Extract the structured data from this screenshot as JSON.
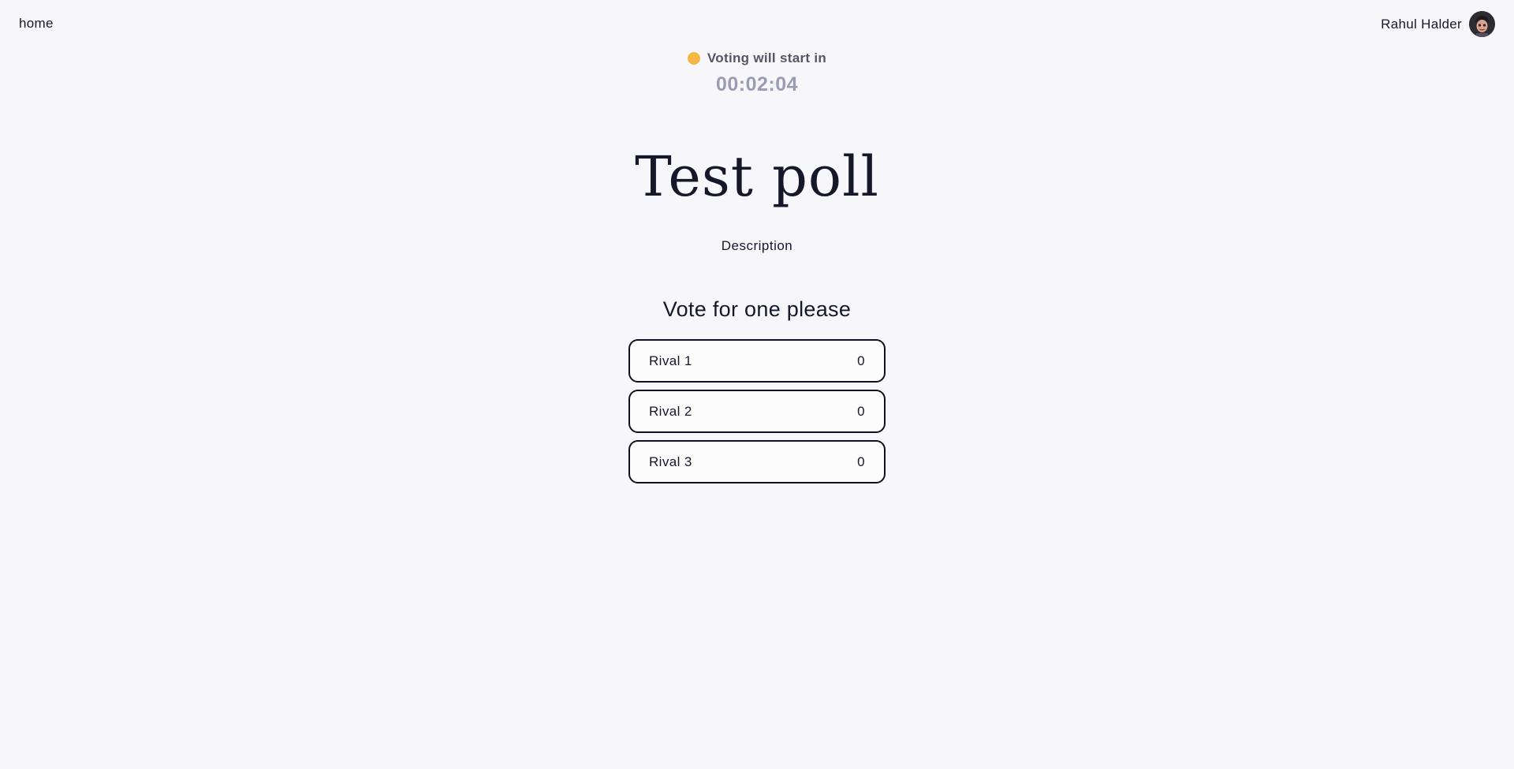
{
  "nav": {
    "home_label": "home",
    "user_name": "Rahul Halder",
    "avatar_icon": "user-avatar-icon"
  },
  "status": {
    "message": "Voting will start in",
    "indicator_color": "#f3b944",
    "countdown": "00:02:04"
  },
  "poll": {
    "title": "Test poll",
    "description": "Description",
    "prompt": "Vote for one please",
    "options": [
      {
        "label": "Rival 1",
        "votes": "0"
      },
      {
        "label": "Rival 2",
        "votes": "0"
      },
      {
        "label": "Rival 3",
        "votes": "0"
      }
    ]
  }
}
